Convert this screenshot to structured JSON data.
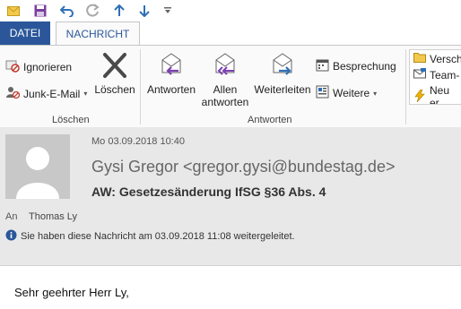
{
  "colors": {
    "accent": "#2b579a",
    "arrow_blue": "#2f6fb6",
    "purple": "#7b3fb0"
  },
  "qat": {
    "icons": [
      "envelope-icon",
      "save-icon",
      "undo-icon",
      "redo-icon",
      "up-arrow-icon",
      "down-arrow-icon",
      "customize-icon"
    ]
  },
  "tabs": {
    "datei": "DATEI",
    "nachricht": "NACHRICHT"
  },
  "ribbon": {
    "loeschen_group": {
      "label": "Löschen",
      "ignorieren": "Ignorieren",
      "junk": "Junk-E-Mail",
      "loeschen": "Löschen"
    },
    "antworten_group": {
      "label": "Antworten",
      "antworten": "Antworten",
      "allen1": "Allen",
      "allen2": "antworten",
      "weiterleiten": "Weiterleiten",
      "besprechung": "Besprechung",
      "weitere": "Weitere"
    },
    "quick": {
      "item1": "Versch",
      "item2": "Team-",
      "item3": "Neu er"
    }
  },
  "message": {
    "date": "Mo 03.09.2018 10:40",
    "sender": "Gysi Gregor <gregor.gysi@bundestag.de>",
    "subject": "AW: Gesetzesänderung IfSG §36 Abs. 4",
    "to_label": "An",
    "to_value": "Thomas Ly",
    "info": "Sie haben diese Nachricht am 03.09.2018 11:08 weitergeleitet.",
    "greeting": "Sehr geehrter Herr Ly,"
  }
}
